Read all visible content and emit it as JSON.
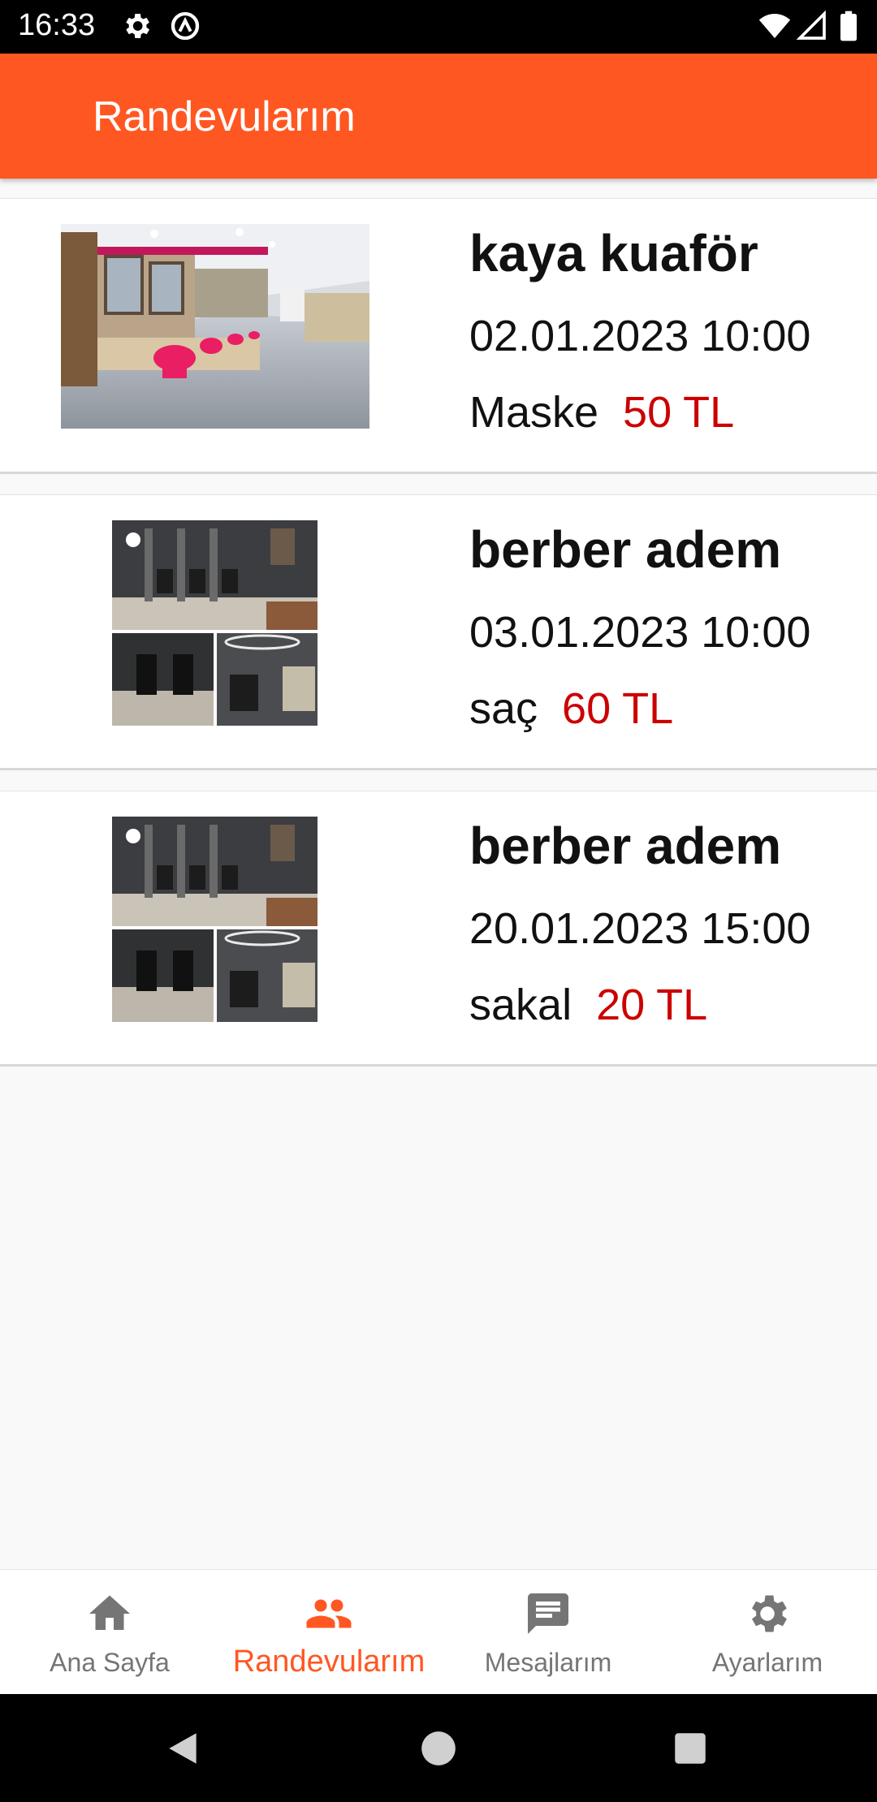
{
  "status_bar": {
    "time": "16:33"
  },
  "app_bar": {
    "title": "Randevularım"
  },
  "appointments": [
    {
      "name": "kaya kuaför",
      "datetime": "02.01.2023 10:00",
      "service": "Maske",
      "price": "50 TL"
    },
    {
      "name": "berber adem",
      "datetime": "03.01.2023 10:00",
      "service": "saç",
      "price": "60 TL"
    },
    {
      "name": "berber adem",
      "datetime": "20.01.2023 15:00",
      "service": "sakal",
      "price": "20 TL"
    }
  ],
  "bottom_nav": {
    "items": [
      {
        "label": "Ana Sayfa",
        "icon": "home-icon"
      },
      {
        "label": "Randevularım",
        "icon": "people-icon"
      },
      {
        "label": "Mesajlarım",
        "icon": "message-icon"
      },
      {
        "label": "Ayarlarım",
        "icon": "gear-icon"
      }
    ],
    "active_index": 1
  },
  "colors": {
    "accent": "#ff5722",
    "price": "#cc0000",
    "inactive": "#757575"
  }
}
